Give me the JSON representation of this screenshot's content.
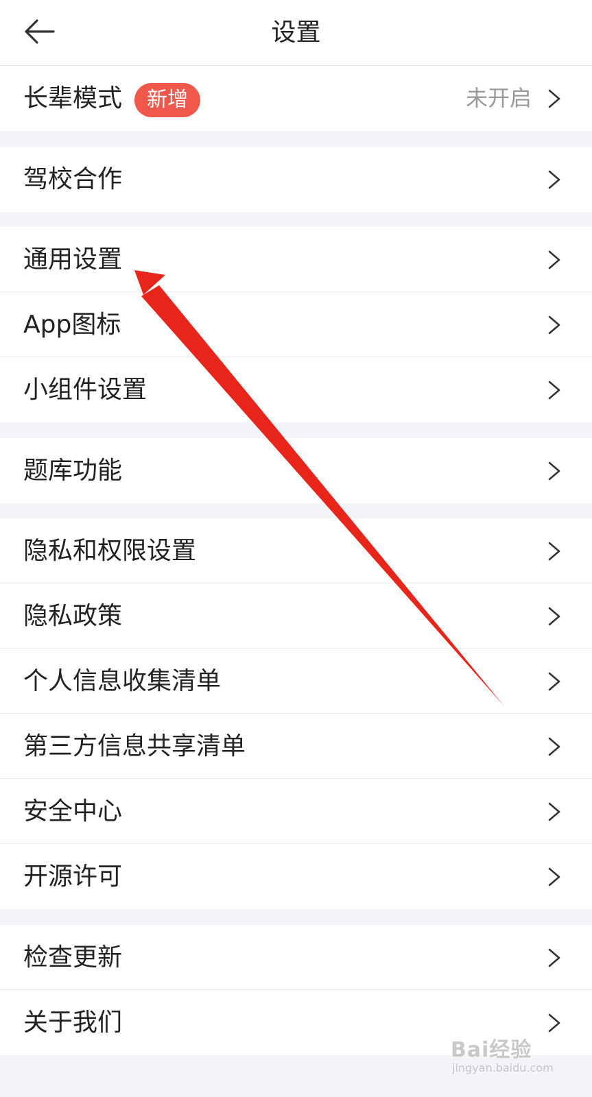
{
  "header": {
    "title": "设置",
    "back_icon": "arrow-left-icon"
  },
  "rows": {
    "elder_mode": {
      "label": "长辈模式",
      "badge": "新增",
      "status": "未开启"
    },
    "driving_school": {
      "label": "驾校合作"
    },
    "general": {
      "label": "通用设置"
    },
    "app_icon": {
      "label": "App图标"
    },
    "widget": {
      "label": "小组件设置"
    },
    "question_bank": {
      "label": "题库功能"
    },
    "privacy_permissions": {
      "label": "隐私和权限设置"
    },
    "privacy_policy": {
      "label": "隐私政策"
    },
    "personal_info": {
      "label": "个人信息收集清单"
    },
    "third_party": {
      "label": "第三方信息共享清单"
    },
    "security": {
      "label": "安全中心"
    },
    "open_source": {
      "label": "开源许可"
    },
    "check_update": {
      "label": "检查更新"
    },
    "about_us": {
      "label": "关于我们"
    }
  },
  "watermark": {
    "logo": "Bai经验",
    "url": "jingyan.baidu.com"
  },
  "colors": {
    "badge": "#f0584b",
    "arrow": "#e8251b",
    "background": "#f3f4f7",
    "status_text": "#999999"
  }
}
